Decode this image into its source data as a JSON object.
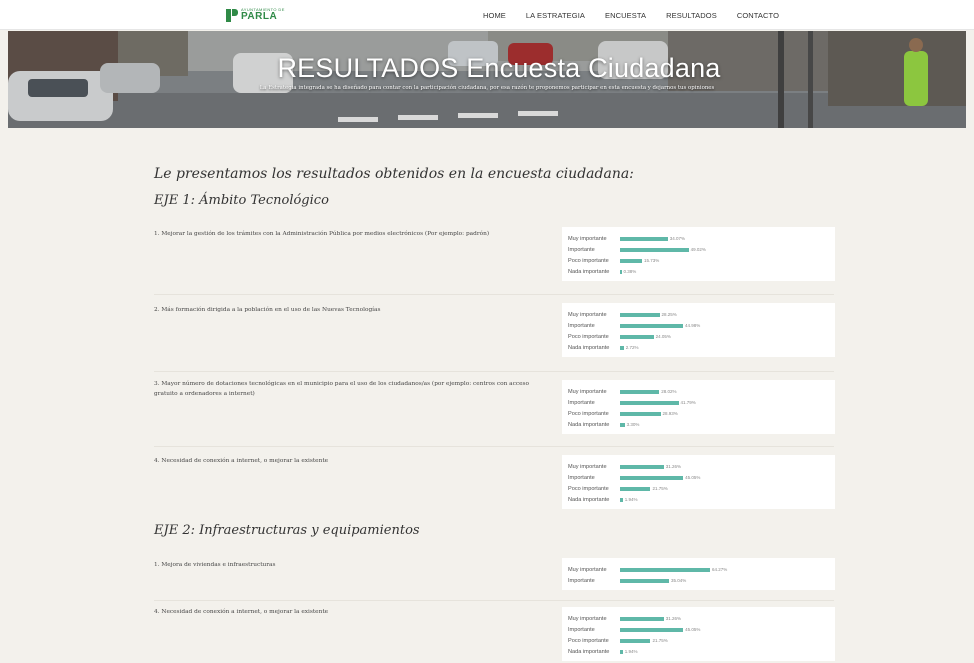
{
  "nav": {
    "logo_top": "AYUNTAMIENTO DE",
    "logo_main": "PARLA",
    "items": [
      "HOME",
      "LA ESTRATEGIA",
      "ENCUESTA",
      "RESULTADOS",
      "CONTACTO"
    ]
  },
  "hero": {
    "title": "RESULTADOS Encuesta Ciudadana",
    "subtitle": "La Estrategia integrada se ha diseñado para contar con la participación ciudadana, por esa razón te proponemos participar en esta encuesta y dejarnos tus opiniones"
  },
  "intro": "Le presentamos los resultados obtenidos en la encuesta ciudadana:",
  "sections": [
    {
      "title": "EJE 1: Ámbito Tecnológico",
      "questions": [
        {
          "text": "1. Mejorar la gestión de los trámites con la Administración Pública por medios electrónicos (Por ejemplo: padrón)",
          "results": [
            {
              "label": "Muy importante",
              "value": 34.07,
              "display": "34.07%"
            },
            {
              "label": "Importante",
              "value": 49.02,
              "display": "49.02%"
            },
            {
              "label": "Poco importante",
              "value": 15.73,
              "display": "15.73%"
            },
            {
              "label": "Nada importante",
              "value": 0.38,
              "display": "0.38%"
            }
          ]
        },
        {
          "text": "2. Más formación dirigida a la población en el uso de las Nuevas Tecnologías",
          "results": [
            {
              "label": "Muy importante",
              "value": 28.25,
              "display": "28.25%"
            },
            {
              "label": "Importante",
              "value": 44.98,
              "display": "44.98%"
            },
            {
              "label": "Poco importante",
              "value": 24.05,
              "display": "24.05%"
            },
            {
              "label": "Nada importante",
              "value": 2.72,
              "display": "2.72%"
            }
          ]
        },
        {
          "text": "3. Mayor número de dotaciones tecnológicas en el municipio para el uso de los ciudadanos/as (por ejemplo: centros con acceso gratuito a ordenadores a internet)",
          "results": [
            {
              "label": "Muy importante",
              "value": 28.02,
              "display": "28.02%"
            },
            {
              "label": "Importante",
              "value": 41.79,
              "display": "41.79%"
            },
            {
              "label": "Poco importante",
              "value": 28.93,
              "display": "28.93%"
            },
            {
              "label": "Nada importante",
              "value": 3.3,
              "display": "3.30%"
            }
          ]
        },
        {
          "text": "4. Necesidad de conexión a internet, o mejorar la existente",
          "results": [
            {
              "label": "Muy importante",
              "value": 31.26,
              "display": "31.26%"
            },
            {
              "label": "Importante",
              "value": 45.05,
              "display": "45.05%"
            },
            {
              "label": "Poco importante",
              "value": 21.75,
              "display": "21.75%"
            },
            {
              "label": "Nada importante",
              "value": 1.94,
              "display": "1.94%"
            }
          ]
        }
      ]
    },
    {
      "title": "EJE 2: Infraestructuras y equipamientos",
      "questions": [
        {
          "text": "1. Mejora de viviendas e infraestructuras",
          "results": [
            {
              "label": "Muy importante",
              "value": 64.27,
              "display": "64.27%"
            },
            {
              "label": "Importante",
              "value": 35.04,
              "display": "35.04%"
            }
          ]
        },
        {
          "text": "4. Necesidad de conexión a internet, o mejorar la existente",
          "results": [
            {
              "label": "Muy importante",
              "value": 31.26,
              "display": "31.26%"
            },
            {
              "label": "Importante",
              "value": 45.05,
              "display": "45.05%"
            },
            {
              "label": "Poco importante",
              "value": 21.75,
              "display": "21.75%"
            },
            {
              "label": "Nada importante",
              "value": 1.94,
              "display": "1.94%"
            }
          ]
        }
      ]
    }
  ],
  "colors": {
    "bar": "#5fb8a8",
    "brand": "#2f8a47"
  }
}
